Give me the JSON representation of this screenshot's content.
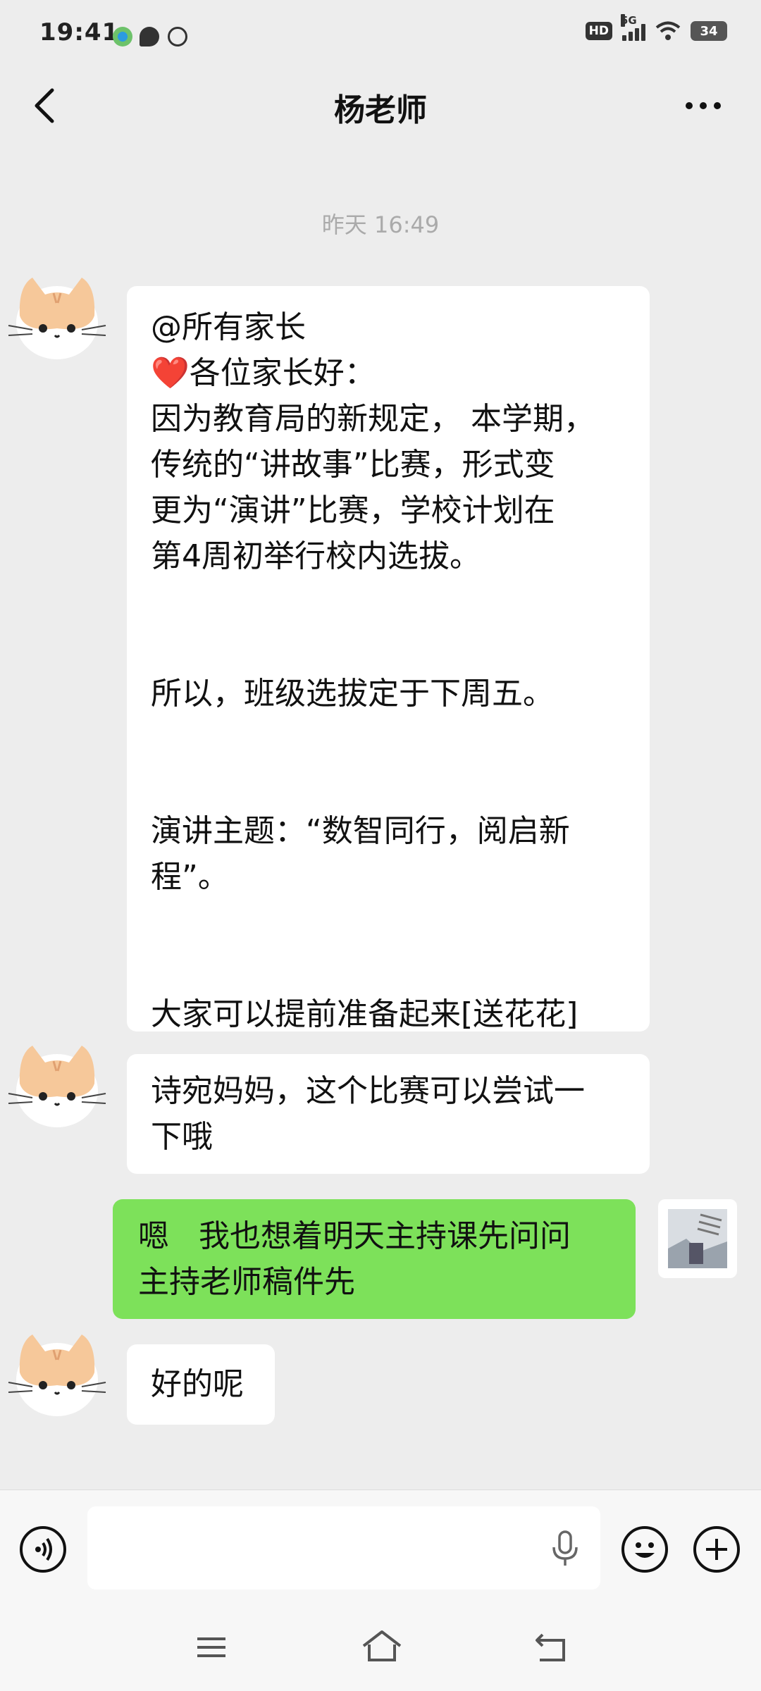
{
  "status_bar": {
    "time": "19:41",
    "hd": "HD",
    "network": "5G",
    "battery": "34"
  },
  "header": {
    "title": "杨老师"
  },
  "chat": {
    "timestamp": "昨天 16:49",
    "messages": [
      {
        "sender": "teacher",
        "lines": [
          "@所有家长",
          "❤️各位家长好：",
          "因为教育局的新规定， 本学期，",
          "传统的“讲故事”比赛，形式变",
          "更为“演讲”比赛，学校计划在",
          "第4周初举行校内选拔。",
          "",
          "",
          "所以，班级选拔定于下周五。",
          "",
          "",
          "演讲主题：“数智同行，阅启新",
          "程”。",
          "",
          "",
          "大家可以提前准备起来[送花花]"
        ]
      },
      {
        "sender": "teacher",
        "lines": [
          "诗宛妈妈，这个比赛可以尝试一",
          "下哦"
        ]
      },
      {
        "sender": "me",
        "lines": [
          "嗯   我也想着明天主持课先问问",
          "主持老师稿件先"
        ]
      },
      {
        "sender": "teacher",
        "lines": [
          "好的呢"
        ]
      }
    ]
  },
  "colors": {
    "background": "#ededed",
    "bubble_incoming": "#ffffff",
    "bubble_outgoing": "#7de15a"
  },
  "icons": {
    "back": "back-chevron-icon",
    "more": "more-dots-icon",
    "voice": "voice-toggle-icon",
    "mic": "microphone-icon",
    "emoji": "emoji-icon",
    "plus": "plus-icon",
    "menu": "menu-lines-icon",
    "home": "home-icon",
    "back_nav": "back-nav-icon"
  }
}
